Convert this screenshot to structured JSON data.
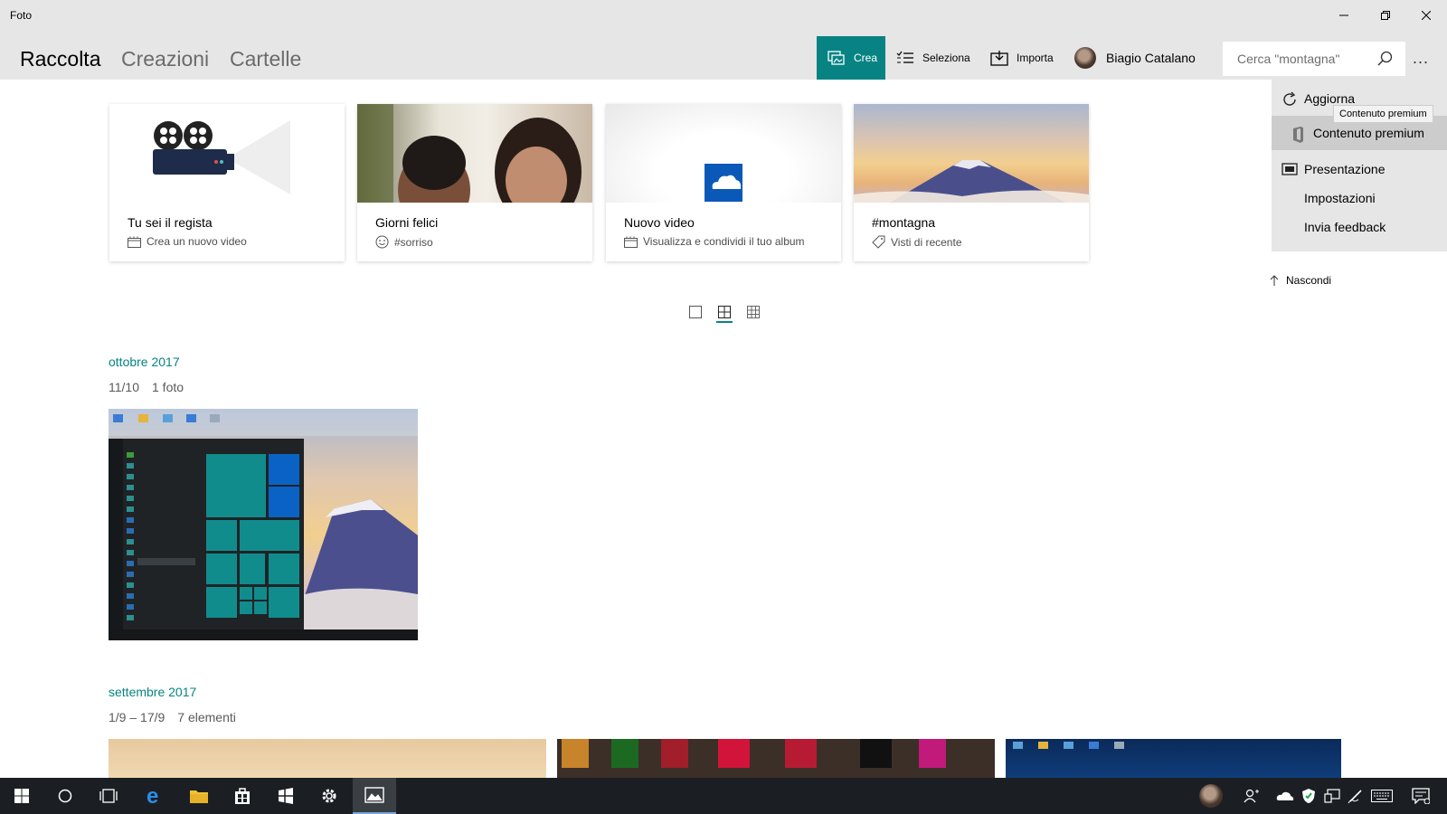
{
  "window": {
    "title": "Foto"
  },
  "nav": {
    "tabs": [
      {
        "label": "Raccolta",
        "active": true
      },
      {
        "label": "Creazioni"
      },
      {
        "label": "Cartelle"
      }
    ]
  },
  "toolbar": {
    "crea_label": "Crea",
    "seleziona_label": "Seleziona",
    "importa_label": "Importa",
    "user_name": "Biagio Catalano",
    "search_placeholder": "Cerca \"montagna\"",
    "more_label": "..."
  },
  "cards": [
    {
      "title": "Tu sei il regista",
      "subtitle": "Crea un nuovo video",
      "icon": "video-icon"
    },
    {
      "title": "Giorni felici",
      "subtitle": "#sorriso",
      "icon": "smile-icon"
    },
    {
      "title": "Nuovo video",
      "subtitle": "Visualizza e condividi il tuo album",
      "icon": "video-icon"
    },
    {
      "title": "#montagna",
      "subtitle": "Visti di recente",
      "icon": "tag-icon"
    }
  ],
  "menu": {
    "items": [
      {
        "label": "Aggiorna",
        "icon": "refresh-icon"
      },
      {
        "label": "Contenuto premium",
        "icon": "office-icon",
        "hovered": true
      },
      {
        "label": "Presentazione",
        "icon": "slideshow-icon"
      },
      {
        "label": "Impostazioni"
      },
      {
        "label": "Invia feedback"
      }
    ],
    "tooltip": "Contenuto premium",
    "hide_label": "Nascondi"
  },
  "view_modes": [
    "large",
    "medium",
    "small"
  ],
  "active_view_mode": "medium",
  "sections": [
    {
      "month": "ottobre 2017",
      "date_range": "11/10",
      "count": "1 foto"
    },
    {
      "month": "settembre 2017",
      "date_range": "1/9 – 17/9",
      "count": "7 elementi"
    }
  ],
  "colors": {
    "accent": "#078383",
    "chrome": "#e6e6e6",
    "taskbar": "#1b1f23"
  }
}
